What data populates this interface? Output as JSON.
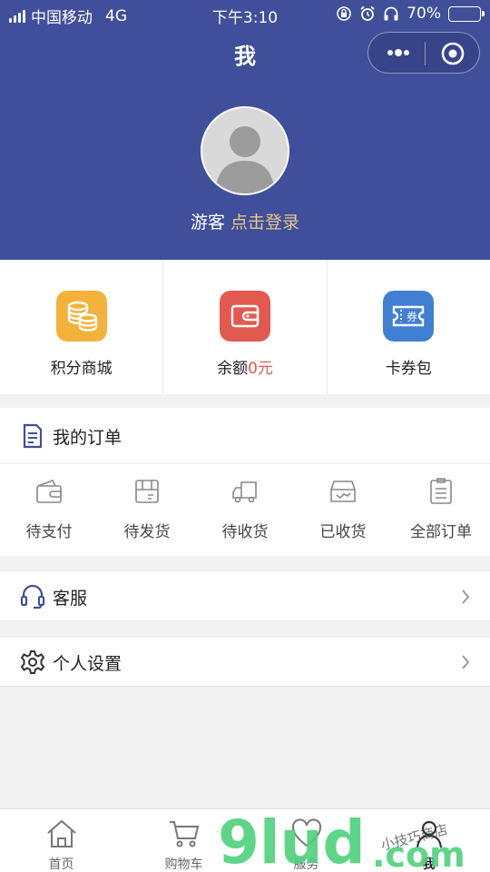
{
  "status_bar": {
    "carrier": "中国移动",
    "network": "4G",
    "time": "下午3:10",
    "battery": "70%",
    "battery_level": 0.7
  },
  "header": {
    "title": "我",
    "guest_label": "游客",
    "login_link": "点击登录"
  },
  "quick_actions": {
    "points_mall": {
      "label": "积分商城",
      "icon": "coins-icon",
      "color": "#f3b23a"
    },
    "balance": {
      "label": "余额",
      "value": "0元",
      "icon": "wallet-icon",
      "color": "#e25a4f"
    },
    "coupons": {
      "label": "卡券包",
      "icon": "ticket-icon",
      "badge": "券",
      "color": "#3f7fd4"
    }
  },
  "orders": {
    "title": "我的订单",
    "items": [
      {
        "label": "待支付",
        "icon": "wallet-outline-icon"
      },
      {
        "label": "待发货",
        "icon": "package-icon"
      },
      {
        "label": "待收货",
        "icon": "truck-icon"
      },
      {
        "label": "已收货",
        "icon": "inbox-check-icon"
      },
      {
        "label": "全部订单",
        "icon": "clipboard-icon"
      }
    ]
  },
  "menu": {
    "service": {
      "label": "客服",
      "icon": "headset-icon"
    },
    "settings": {
      "label": "个人设置",
      "icon": "gear-icon"
    }
  },
  "tabbar": {
    "items": [
      {
        "label": "首页",
        "icon": "home-icon"
      },
      {
        "label": "购物车",
        "icon": "cart-icon"
      },
      {
        "label": "服务",
        "icon": "heart-icon"
      },
      {
        "label": "我",
        "icon": "user-icon",
        "active": true
      }
    ]
  },
  "watermark": {
    "brand": "9lud",
    "suffix": ".com",
    "tagline": "小技巧商店"
  },
  "colors": {
    "header_bg": "#3f4f9a",
    "login_accent": "#e8c68b",
    "balance_red": "#e25a4f",
    "watermark_green": "#4cd07a"
  }
}
